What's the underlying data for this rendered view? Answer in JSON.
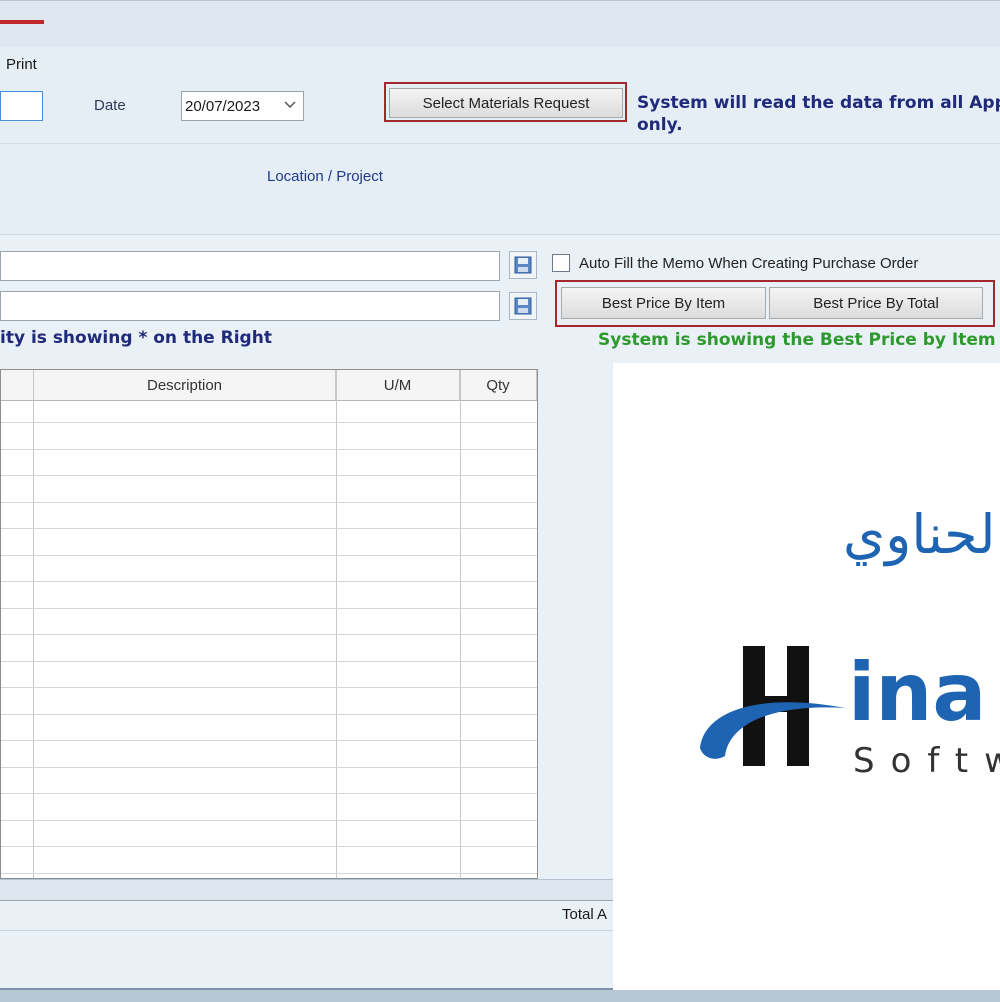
{
  "header": {
    "print_label": "Print"
  },
  "form": {
    "date_label": "Date",
    "date_value": "20/07/2023",
    "select_mr_button": "Select Materials Request",
    "note_line1": "System will read the data from all Appro",
    "note_line2": "only.",
    "location_label": "Location / Project",
    "autofill_label": "Auto Fill the Memo When Creating Purchase Order",
    "best_price_item_button": "Best Price By Item",
    "best_price_total_button": "Best Price By Total",
    "quantity_note": "ity is showing * on the Right",
    "best_price_note": "System is showing the Best Price by Item"
  },
  "grid": {
    "columns": [
      "Description",
      "U/M",
      "Qty"
    ]
  },
  "footer": {
    "total_label": "Total A"
  },
  "logo": {
    "arabic_text": "الحناوي",
    "latin_text": "ina",
    "tagline": "Softw"
  },
  "colors": {
    "accent_red": "#a5262b",
    "navy_text": "#1f2a7a",
    "green_text": "#2e9a2e",
    "logo_blue": "#1f64b3"
  }
}
